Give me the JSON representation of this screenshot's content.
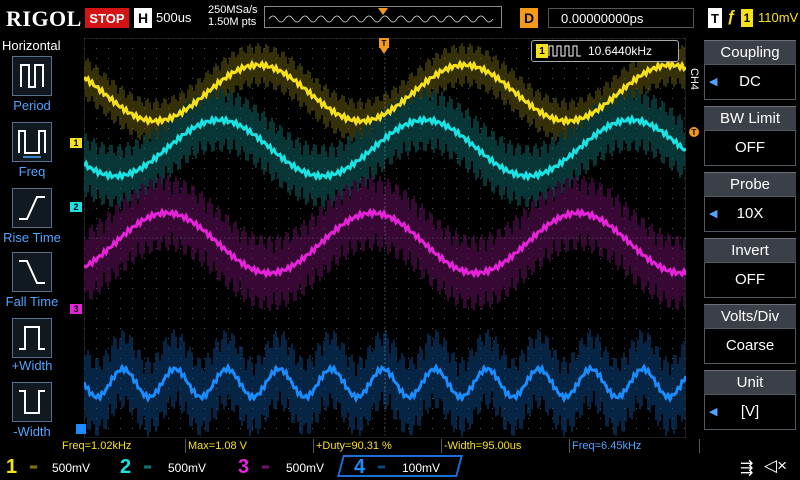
{
  "brand": "RIGOL",
  "status": "STOP",
  "timebase": {
    "label": "H",
    "value": "500us"
  },
  "sample": {
    "rate": "250MSa/s",
    "points": "1.50M pts"
  },
  "delay": {
    "label": "D",
    "value": "0.00000000ps"
  },
  "trigger": {
    "label": "T",
    "channel": "1",
    "level": "110mV"
  },
  "left_menu": {
    "title": "Horizontal",
    "items": [
      "Period",
      "Freq",
      "Rise Time",
      "Fall Time",
      "+Width",
      "-Width"
    ]
  },
  "freq_popup": {
    "channel": "1",
    "value": "10.6440kHz"
  },
  "right_menu": {
    "channel_tag": "CH4",
    "items": [
      {
        "title": "Coupling",
        "value": "DC"
      },
      {
        "title": "BW Limit",
        "value": "OFF"
      },
      {
        "title": "Probe",
        "value": "10X"
      },
      {
        "title": "Invert",
        "value": "OFF"
      },
      {
        "title": "Volts/Div",
        "value": "Coarse"
      },
      {
        "title": "Unit",
        "value": "[V]"
      }
    ]
  },
  "measurements": [
    {
      "text": "Freq=1.02kHz",
      "color": "#f7e11b"
    },
    {
      "text": "Max=1.08 V",
      "color": "#f7e11b"
    },
    {
      "text": "+Duty=90.31 %",
      "color": "#f7e11b"
    },
    {
      "text": "-Width=95.00us",
      "color": "#f7e11b"
    },
    {
      "text": "Freq=6.45kHz",
      "color": "#4fa4ff"
    }
  ],
  "channels": [
    {
      "num": "1",
      "scale": "500mV",
      "color": "#f7e11b"
    },
    {
      "num": "2",
      "scale": "500mV",
      "color": "#19e3e3"
    },
    {
      "num": "3",
      "scale": "500mV",
      "color": "#e623d8"
    },
    {
      "num": "4",
      "scale": "100mV",
      "color": "#1a8cff"
    }
  ]
}
